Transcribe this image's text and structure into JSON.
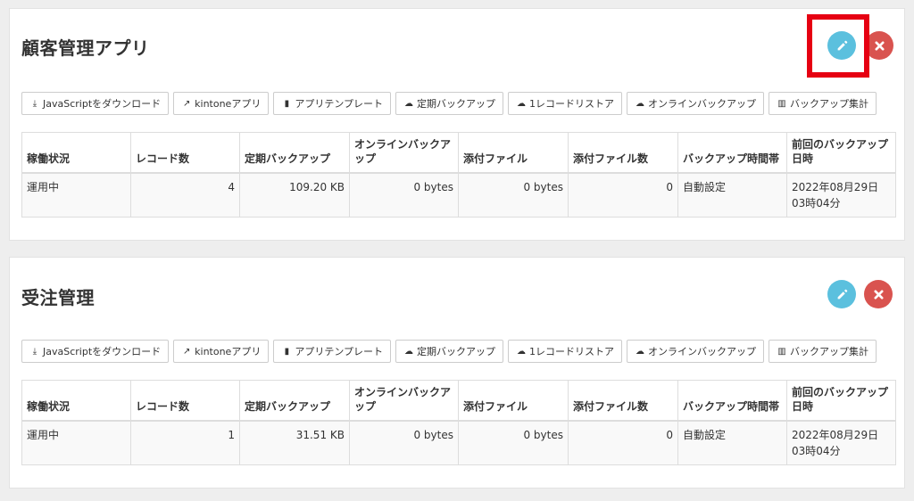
{
  "toolbar": {
    "download_js": "JavaScriptをダウンロード",
    "kintone_app": "kintoneアプリ",
    "app_template": "アプリテンプレート",
    "periodic_backup": "定期バックアップ",
    "one_record_restore": "1レコードリストア",
    "online_backup": "オンラインバックアップ",
    "backup_stats": "バックアップ集計"
  },
  "columns": [
    "稼働状況",
    "レコード数",
    "定期バックアップ",
    "オンラインバックアップ",
    "添付ファイル",
    "添付ファイル数",
    "バックアップ時間帯",
    "前回のバックアップ日時"
  ],
  "apps": [
    {
      "title": "顧客管理アプリ",
      "row": [
        "運用中",
        "4",
        "109.20 KB",
        "0 bytes",
        "0 bytes",
        "0",
        "自動設定",
        "2022年08月29日03時04分"
      ]
    },
    {
      "title": "受注管理",
      "row": [
        "運用中",
        "1",
        "31.51 KB",
        "0 bytes",
        "0 bytes",
        "0",
        "自動設定",
        "2022年08月29日03時04分"
      ]
    }
  ],
  "colors": {
    "edit": "#5bc0de",
    "delete": "#d9534f",
    "highlight": "#e60012"
  }
}
